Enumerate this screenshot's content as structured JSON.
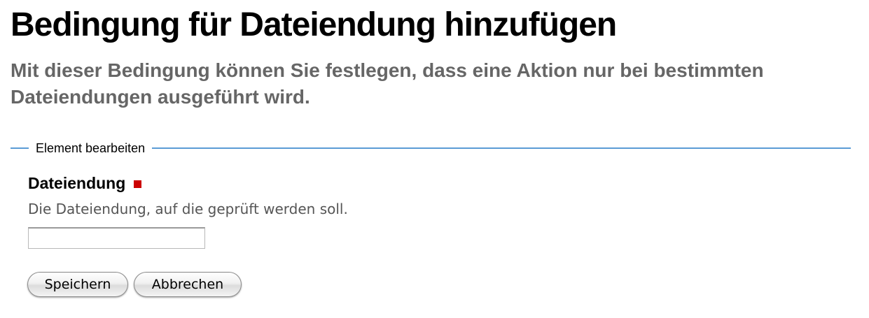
{
  "header": {
    "title": "Bedingung für Dateiendung hinzufügen",
    "subtitle": "Mit dieser Bedingung können Sie festlegen, dass eine Aktion nur bei bestimmten Dateiendungen ausgeführt wird."
  },
  "form": {
    "legend": "Element bearbeiten",
    "field": {
      "label": "Dateiendung",
      "description": "Die Dateiendung, auf die geprüft werden soll.",
      "value": "",
      "placeholder": ""
    },
    "buttons": {
      "save_label": "Speichern",
      "cancel_label": "Abbrechen"
    }
  },
  "colors": {
    "accent_line": "#5b9bd5",
    "required_marker": "#cc0000",
    "subtitle_text": "#666666"
  }
}
